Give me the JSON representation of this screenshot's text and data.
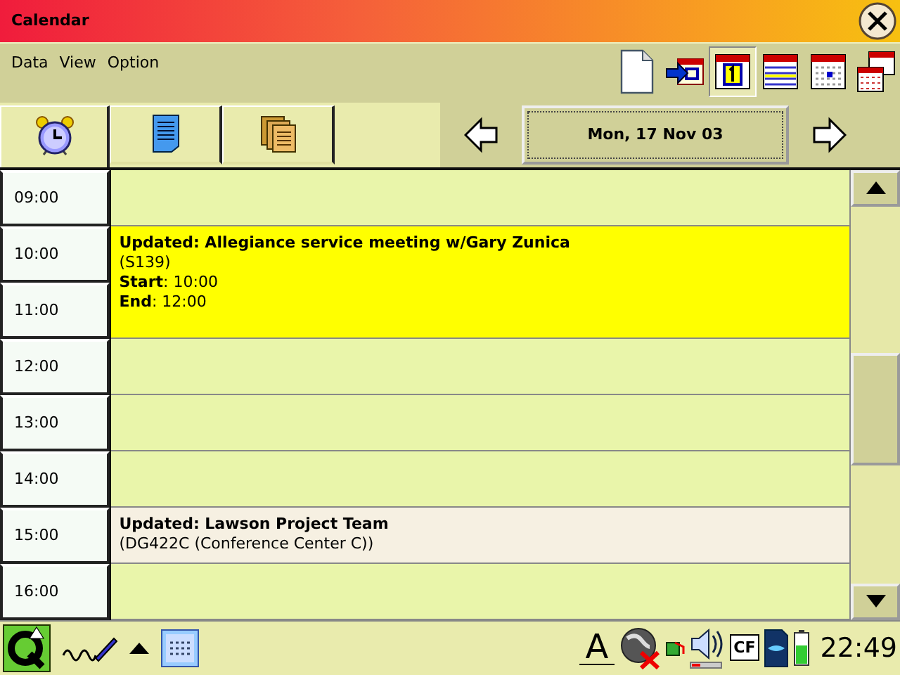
{
  "window": {
    "title": "Calendar"
  },
  "menu": [
    "Data",
    "View",
    "Option"
  ],
  "view_buttons": [
    {
      "kind": "new",
      "selected": false
    },
    {
      "kind": "import",
      "selected": false
    },
    {
      "kind": "day",
      "selected": true
    },
    {
      "kind": "list",
      "selected": false
    },
    {
      "kind": "week",
      "selected": false
    },
    {
      "kind": "month",
      "selected": false
    }
  ],
  "tabs": [
    {
      "kind": "alarm",
      "selected": true
    },
    {
      "kind": "note",
      "selected": false
    },
    {
      "kind": "notes",
      "selected": false
    }
  ],
  "date_nav": {
    "date": "Mon, 17 Nov 03"
  },
  "slots": [
    {
      "kind": "empty",
      "times": [
        "09:00"
      ]
    },
    {
      "kind": "event",
      "times": [
        "10:00",
        "11:00"
      ],
      "color": "#ffff00",
      "title": "Updated: Allegiance service meeting w/Gary Zunica",
      "lines": [
        "(S139)",
        "**Start**: 10:00",
        "**End**: 12:00"
      ]
    },
    {
      "kind": "empty",
      "times": [
        "12:00"
      ]
    },
    {
      "kind": "empty",
      "times": [
        "13:00"
      ]
    },
    {
      "kind": "empty",
      "times": [
        "14:00"
      ]
    },
    {
      "kind": "event",
      "times": [
        "15:00"
      ],
      "color": "#f6f0e2",
      "title": "Updated: Lawson Project Team",
      "lines": [
        "(DG422C (Conference Center C))"
      ]
    },
    {
      "kind": "empty",
      "times": [
        "16:00"
      ]
    }
  ],
  "taskbar": {
    "tray_input": "A",
    "cf_card": "CF",
    "clock": "22:49"
  }
}
